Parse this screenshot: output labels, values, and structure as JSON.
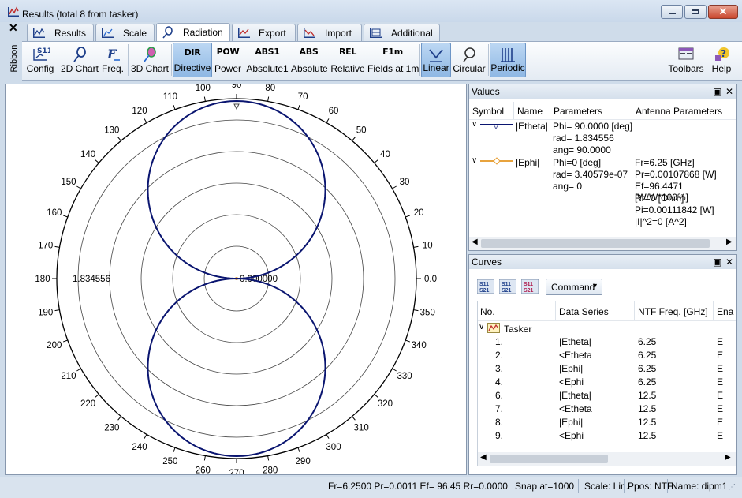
{
  "window": {
    "title": "Results (total 8 from tasker)"
  },
  "tabs": [
    {
      "label": "Results",
      "active": false
    },
    {
      "label": "Scale",
      "active": false
    },
    {
      "label": "Radiation",
      "active": true
    },
    {
      "label": "Export",
      "active": false
    },
    {
      "label": "Import",
      "active": false
    },
    {
      "label": "Additional",
      "active": false
    }
  ],
  "ribbon": {
    "side_label": "Ribbon",
    "close_glyph": "✕",
    "buttons": [
      {
        "label": "Config",
        "icon": "S11"
      },
      {
        "label": "2D Chart",
        "icon": "2d-chart-icon"
      },
      {
        "label": "Freq.",
        "icon": "F"
      },
      {
        "label": "3D Chart",
        "icon": "3d-chart-icon"
      },
      {
        "label": "Directive",
        "icon": "DIR",
        "selected": true
      },
      {
        "label": "Power",
        "icon": "POW"
      },
      {
        "label": "Absolute1",
        "icon": "ABS1"
      },
      {
        "label": "Absolute",
        "icon": "ABS"
      },
      {
        "label": "Relative",
        "icon": "REL"
      },
      {
        "label": "Fields at 1m",
        "icon": "F1m"
      },
      {
        "label": "Linear",
        "icon": "linear-icon",
        "selected": true
      },
      {
        "label": "Circular",
        "icon": "circular-icon"
      },
      {
        "label": "Periodic",
        "icon": "periodic-icon",
        "selected": true
      },
      {
        "label": "Toolbars",
        "icon": "toolbars-icon"
      },
      {
        "label": "Help",
        "icon": "help-icon"
      }
    ]
  },
  "chart_data": {
    "type": "polar",
    "angle_labels": [
      "0.0",
      "10",
      "20",
      "30",
      "40",
      "50",
      "60",
      "70",
      "80",
      "90",
      "100",
      "110",
      "120",
      "130",
      "140",
      "150",
      "160",
      "170",
      "180",
      "190",
      "200",
      "210",
      "220",
      "230",
      "240",
      "250",
      "260",
      "270",
      "280",
      "290",
      "300",
      "310",
      "320",
      "330",
      "340",
      "350"
    ],
    "radius_max_label": "1.834556",
    "radius_min_label": "0.000000",
    "rmax": 1.834556,
    "rmin": 0,
    "rings": 5,
    "series": [
      {
        "name": "|Etheta|",
        "color": "#0a1570",
        "shape": "sin-theta",
        "max": 1.834556
      },
      {
        "name": "|Ephi|",
        "color": "#e8a33d",
        "max": 3.40579e-07
      }
    ]
  },
  "values_panel": {
    "title": "Values",
    "columns": [
      "Symbol",
      "Name",
      "Parameters",
      "Antenna Parameters"
    ],
    "rows": [
      {
        "name": "|Etheta|",
        "color": "#0a1570",
        "params": [
          "Phi= 90.0000 [deg]",
          "rad= 1.834556",
          "ang=  90.0000"
        ],
        "antenna": []
      },
      {
        "name": "|Ephi|",
        "color": "#e8a33d",
        "params": [
          "Phi=0 [deg]",
          "rad= 3.40579e-07",
          "ang= 0"
        ],
        "antenna": [
          "Fr=6.25 [GHz]",
          "Pr=0.00107868 [W]",
          "Ef=96.4471 [W/W*100%]",
          "Rr=0 [Ohm]",
          "Pi=0.00111842 [W]",
          "|I|^2=0 [A^2]"
        ]
      }
    ]
  },
  "curves_panel": {
    "title": "Curves",
    "command_label": "Command",
    "columns": [
      "No.",
      "Data Series",
      "NTF Freq. [GHz]",
      "Ena"
    ],
    "group": "Tasker",
    "rows": [
      {
        "no": "1.",
        "series": "|Etheta|",
        "freq": "6.25",
        "ena": "E"
      },
      {
        "no": "2.",
        "series": "<Etheta",
        "freq": "6.25",
        "ena": "E"
      },
      {
        "no": "3.",
        "series": "|Ephi|",
        "freq": "6.25",
        "ena": "E"
      },
      {
        "no": "4.",
        "series": "<Ephi",
        "freq": "6.25",
        "ena": "E"
      },
      {
        "no": "6.",
        "series": "|Etheta|",
        "freq": "12.5",
        "ena": "E"
      },
      {
        "no": "7.",
        "series": "<Etheta",
        "freq": "12.5",
        "ena": "E"
      },
      {
        "no": "8.",
        "series": "|Ephi|",
        "freq": "12.5",
        "ena": "E"
      },
      {
        "no": "9.",
        "series": "<Ephi",
        "freq": "12.5",
        "ena": "E"
      }
    ]
  },
  "status": {
    "summary": "Fr=6.2500 Pr=0.0011 Ef= 96.45 Rr=0.0000",
    "snap": "Snap at=1000",
    "scale": "Scale: Lin.",
    "ppos": "Ppos: NTF",
    "name": "Name: dipm1"
  },
  "colors": {
    "accent": "#0a1570",
    "ephi": "#e8a33d",
    "selected": "#9cc2ea"
  }
}
